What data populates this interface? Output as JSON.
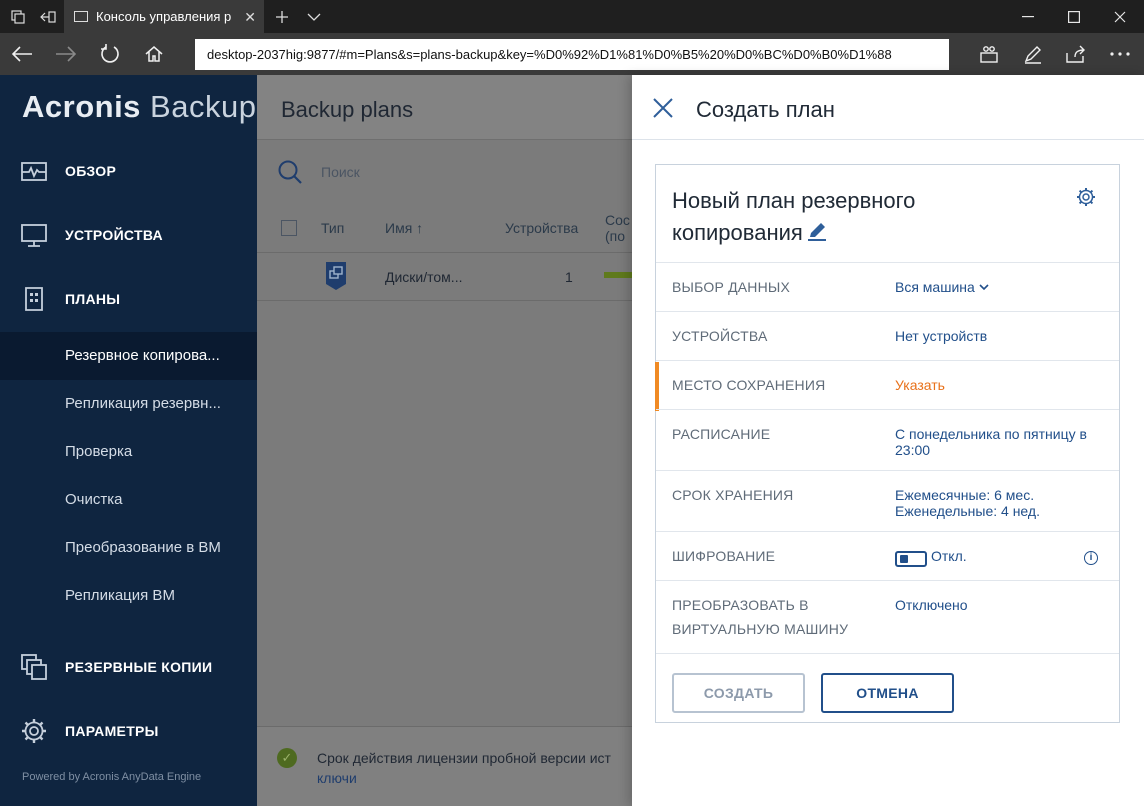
{
  "browser": {
    "tab_title": "Консоль управления р",
    "url": "desktop-2037hig:9877/#m=Plans&s=plans-backup&key=%D0%92%D1%81%D0%B5%20%D0%BC%D0%B0%D1%88"
  },
  "sidebar": {
    "logo_bold": "Acronis",
    "logo_light": "Backup",
    "items": [
      {
        "label": "ОБЗОР",
        "icon": "dashboard-icon"
      },
      {
        "label": "УСТРОЙСТВА",
        "icon": "monitor-icon"
      },
      {
        "label": "ПЛАНЫ",
        "icon": "plans-icon"
      }
    ],
    "subitems": [
      {
        "label": "Резервное копирова..."
      },
      {
        "label": "Репликация резервн..."
      },
      {
        "label": "Проверка"
      },
      {
        "label": "Очистка"
      },
      {
        "label": "Преобразование в ВМ"
      },
      {
        "label": "Репликация ВМ"
      }
    ],
    "bottom_items": [
      {
        "label": "РЕЗЕРВНЫЕ КОПИИ",
        "icon": "backups-icon"
      },
      {
        "label": "ПАРАМЕТРЫ",
        "icon": "gear-icon"
      }
    ],
    "powered_by": "Powered by Acronis AnyData Engine"
  },
  "main": {
    "title": "Backup plans",
    "search_placeholder": "Поиск",
    "columns": [
      "Тип",
      "Имя ↑",
      "Устройства",
      "Сос",
      "(по"
    ],
    "row": {
      "name": "Диски/том...",
      "devices": "1"
    },
    "footer_text": "Срок действия лицензии пробной версии ист",
    "footer_link": "ключи"
  },
  "drawer": {
    "title": "Создать план",
    "plan_name": "Новый план резервного копирования",
    "rows": [
      {
        "label": "ВЫБОР ДАННЫХ",
        "value": "Вся машина"
      },
      {
        "label": "УСТРОЙСТВА",
        "value": "Нет устройств"
      },
      {
        "label": "МЕСТО СОХРАНЕНИЯ",
        "value": "Указать"
      },
      {
        "label": "РАСПИСАНИЕ",
        "value": "С понедельника по пятницу в 23:00"
      },
      {
        "label": "СРОК ХРАНЕНИЯ",
        "value": "Ежемесячные: 6 мес.",
        "value2": "Еженедельные: 4 нед."
      },
      {
        "label": "ШИФРОВАНИЕ",
        "value": "Откл."
      },
      {
        "label": "ПРЕОБРАЗОВАТЬ В ВИРТУАЛЬНУЮ МАШИНУ",
        "value": "Отключено"
      }
    ],
    "create_label": "СОЗДАТЬ",
    "cancel_label": "ОТМЕНА"
  },
  "colors": {
    "sidebar_bg": "#0f2540",
    "link_blue": "#214f8a",
    "warning_orange": "#e8711a"
  }
}
